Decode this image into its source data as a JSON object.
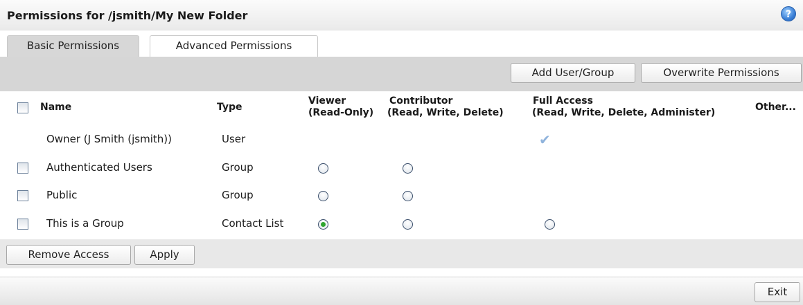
{
  "window": {
    "title": "Permissions for /jsmith/My New Folder",
    "help_icon": "?"
  },
  "tabs": [
    {
      "label": "Basic Permissions",
      "active": true
    },
    {
      "label": "Advanced Permissions",
      "active": false
    }
  ],
  "toolbar": {
    "add_label": "Add User/Group",
    "overwrite_label": "Overwrite Permissions"
  },
  "table": {
    "headers": {
      "name": "Name",
      "type": "Type",
      "viewer": "Viewer",
      "viewer_sub": "(Read-Only)",
      "contributor": "Contributor",
      "contributor_sub": "(Read, Write, Delete)",
      "full": "Full Access",
      "full_sub": "(Read, Write, Delete, Administer)",
      "other": "Other..."
    },
    "rows": [
      {
        "name": "Owner (J Smith (jsmith))",
        "type": "User",
        "permission": "full",
        "checkbox": false
      },
      {
        "name": "Authenticated Users",
        "type": "Group",
        "permission": null,
        "checkbox": true
      },
      {
        "name": "Public",
        "type": "Group",
        "permission": null,
        "checkbox": true
      },
      {
        "name": "This is a Group",
        "type": "Contact List",
        "permission": "viewer",
        "checkbox": true
      }
    ]
  },
  "actions": {
    "remove_label": "Remove Access",
    "apply_label": "Apply"
  },
  "footer": {
    "exit_label": "Exit"
  },
  "colors": {
    "selected_radio": "#2fa52f",
    "toolbar_bg": "#d6d6d6",
    "check": "#8fb3dc"
  }
}
